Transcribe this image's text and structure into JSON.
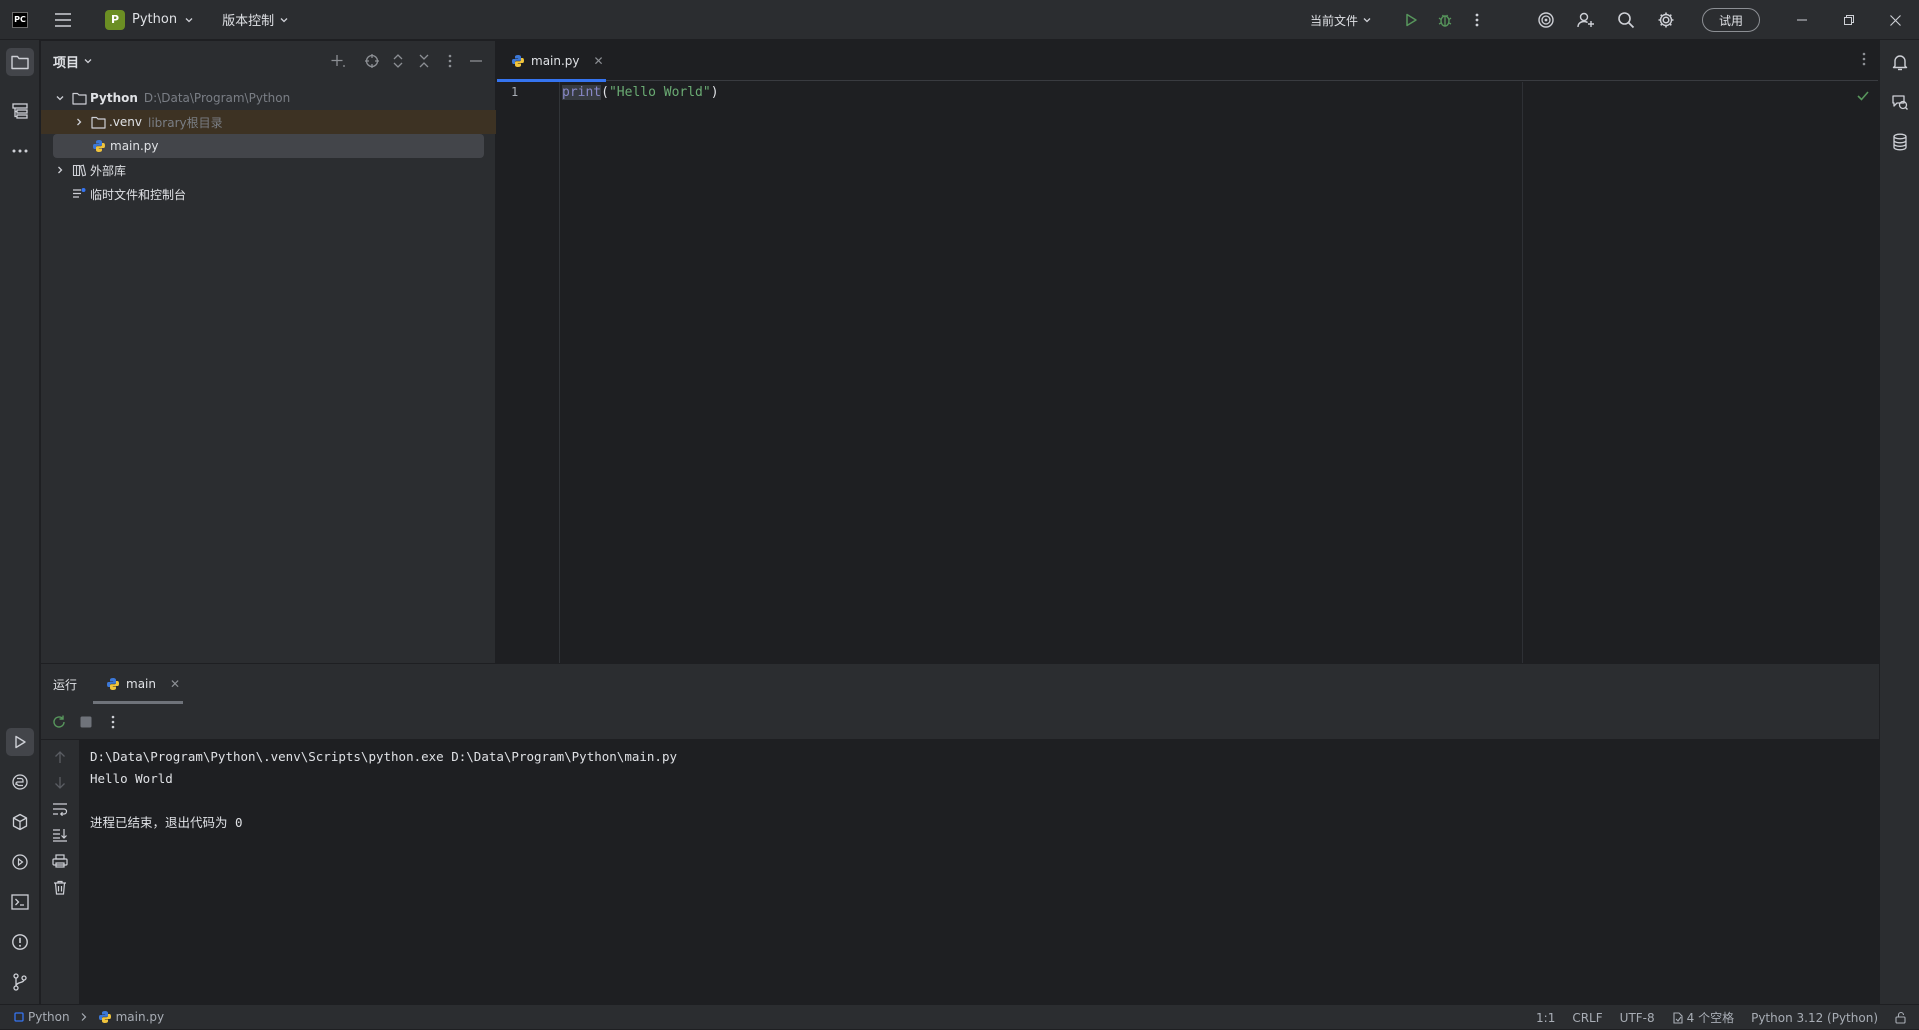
{
  "titlebar": {
    "project_letter": "P",
    "project_name": "Python",
    "vcs_label": "版本控制",
    "run_config": "当前文件",
    "trial_label": "试用"
  },
  "project_panel": {
    "title": "项目",
    "tree": [
      {
        "name": "Python",
        "hint": "D:\\Data\\Program\\Python"
      },
      {
        "name": ".venv",
        "hint": "library根目录"
      },
      {
        "name": "main.py",
        "hint": ""
      },
      {
        "name": "外部库",
        "hint": ""
      },
      {
        "name": "临时文件和控制台",
        "hint": ""
      }
    ]
  },
  "editor": {
    "tab_label": "main.py",
    "line_number": "1",
    "code": {
      "fn": "print",
      "open": "(",
      "string": "\"Hello World\"",
      "close": ")"
    }
  },
  "run_panel": {
    "label": "运行",
    "tab_label": "main",
    "console": [
      "D:\\Data\\Program\\Python\\.venv\\Scripts\\python.exe D:\\Data\\Program\\Python\\main.py",
      "Hello World",
      "",
      "进程已结束，退出代码为 0"
    ]
  },
  "statusbar": {
    "crumb_project": "Python",
    "crumb_file": "main.py",
    "position": "1:1",
    "line_sep": "CRLF",
    "encoding": "UTF-8",
    "indent": "4 个空格",
    "interpreter": "Python 3.12 (Python)"
  },
  "colors": {
    "accent": "#3574f0",
    "run_green": "#57965c",
    "string_green": "#6aab73",
    "function_purple": "#8888c6"
  }
}
